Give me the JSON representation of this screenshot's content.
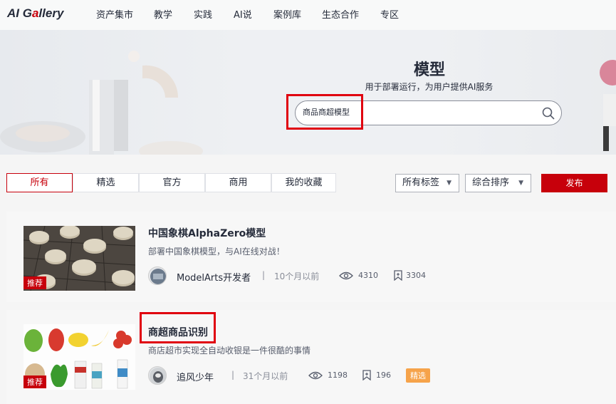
{
  "header": {
    "logo_prefix": "AI G",
    "logo_accent": "a",
    "logo_suffix": "llery",
    "nav": [
      "资产集市",
      "教学",
      "实践",
      "AI说",
      "案例库",
      "生态合作",
      "专区"
    ]
  },
  "hero": {
    "title": "模型",
    "subtitle": "用于部署运行，为用户提供AI服务",
    "search_value": "商品商超模型"
  },
  "tabs": [
    "所有",
    "精选",
    "官方",
    "商用",
    "我的收藏"
  ],
  "filters": {
    "tags_label": "所有标签",
    "sort_label": "综合排序",
    "publish_label": "发布"
  },
  "cards": [
    {
      "title": "中国象棋AlphaZero模型",
      "desc": "部署中国象棋模型，与AI在线对战！",
      "author": "ModelArts开发者",
      "separator": "|",
      "time": "10个月以前",
      "views": "4310",
      "favorites": "3304",
      "badge": "推荐"
    },
    {
      "title": "商超商品识别",
      "desc": "商店超市实现全自动收银是一件很酷的事情",
      "author": "追风少年",
      "separator": "|",
      "time": "31个月以前",
      "views": "1198",
      "favorites": "196",
      "badge": "推荐",
      "tag": "精选"
    }
  ],
  "colors": {
    "brand_red": "#c7000b",
    "highlight_red": "#e0000f",
    "selected_badge": "#f6a34a"
  },
  "icons": [
    "search-icon",
    "eye-icon",
    "bookmark-icon",
    "caret-down-icon"
  ]
}
